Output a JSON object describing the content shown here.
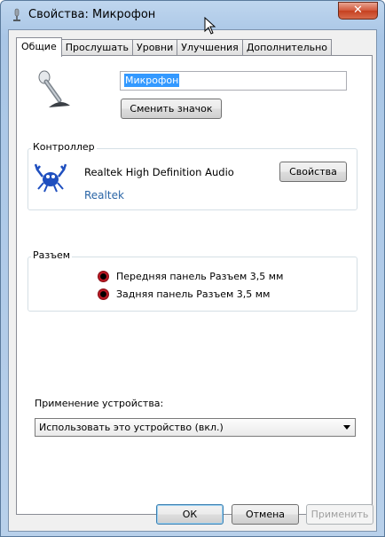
{
  "window": {
    "title": "Свойства: Микрофон",
    "close_glyph": "✕"
  },
  "tabs": [
    {
      "label": "Общие",
      "active": true
    },
    {
      "label": "Прослушать",
      "active": false
    },
    {
      "label": "Уровни",
      "active": false
    },
    {
      "label": "Улучшения",
      "active": false
    },
    {
      "label": "Дополнительно",
      "active": false
    }
  ],
  "general": {
    "device_name_value": "Микрофон",
    "change_icon_label": "Сменить значок"
  },
  "controller": {
    "group_label": "Контроллер",
    "device_label": "Realtek High Definition Audio",
    "properties_label": "Свойства",
    "vendor_link": "Realtek"
  },
  "jack": {
    "group_label": "Разъем",
    "items": [
      {
        "label": "Передняя панель Разъем 3,5 мм"
      },
      {
        "label": "Задняя панель Разъем 3,5 мм"
      }
    ]
  },
  "usage": {
    "label": "Применение устройства:",
    "selected": "Использовать это устройство (вкл.)"
  },
  "footer": {
    "ok_label": "ОК",
    "cancel_label": "Отмена",
    "apply_label": "Применить"
  },
  "colors": {
    "accent": "#3399ff",
    "link": "#2a65a6",
    "jack": "#d21d2a"
  },
  "icons": [
    "microphone-icon",
    "realtek-crab-icon",
    "audio-jack-icon",
    "mouse-cursor-icon"
  ]
}
